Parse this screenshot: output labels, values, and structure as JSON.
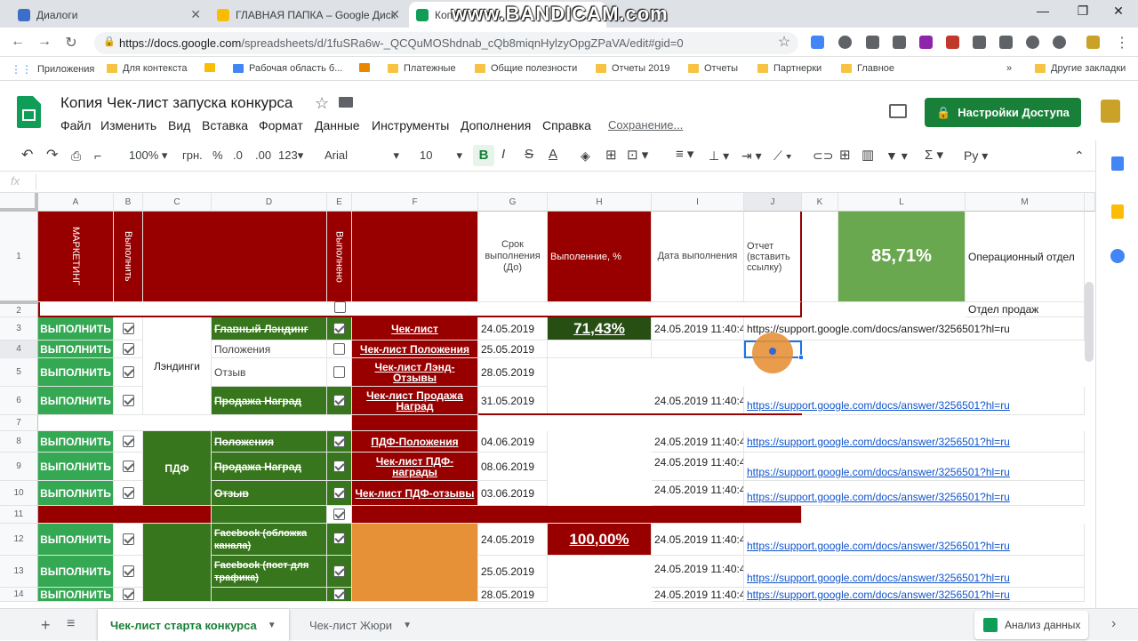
{
  "browser": {
    "tabs": [
      {
        "title": "Диалоги",
        "color": "#3d6ec9"
      },
      {
        "title": "ГЛАВНАЯ ПАПКА – Google Диск",
        "color": "#fbbc04"
      },
      {
        "title": "Копи",
        "color": "#0f9d58"
      }
    ],
    "watermark": "www.BANDICAM.com",
    "url_host": "https://docs.google.com",
    "url_path": "/spreadsheets/d/1fuSRa6w-_QCQuMOShdnab_cQb8miqnHylzyOpgZPaVA/edit#gid=0",
    "bookmarks": [
      "Приложения",
      "Для контекста",
      "Рабочая область б...",
      "Платежные",
      "Общие полезности",
      "Отчеты 2019",
      "Отчеты",
      "Партнерки",
      "Главное"
    ],
    "bookmarks_other": "Другие закладки"
  },
  "sheets": {
    "title": "Копия Чек-лист запуска конкурса",
    "menu": [
      "Файл",
      "Изменить",
      "Вид",
      "Вставка",
      "Формат",
      "Данные",
      "Инструменты",
      "Дополнения",
      "Справка"
    ],
    "saving": "Сохранение...",
    "share_label": "Настройки Доступа",
    "toolbar": {
      "zoom": "100%",
      "currency": "грн.",
      "percent": "%",
      "dec_less": ".0",
      "dec_more": ".00",
      "format_more": "123",
      "font": "Arial",
      "size": "10",
      "input_tool": "Ру"
    },
    "fx": "fx"
  },
  "grid": {
    "columns": [
      "A",
      "B",
      "C",
      "D",
      "E",
      "F",
      "G",
      "H",
      "I",
      "J",
      "K",
      "L",
      "M"
    ],
    "rows": [
      "1",
      "2",
      "3",
      "4",
      "5",
      "6",
      "7",
      "8",
      "9",
      "10",
      "11",
      "12",
      "13",
      "14"
    ],
    "r1": {
      "a": "МАРКЕТИНГ",
      "b": "Выполнить",
      "e": "Выполнено",
      "g": "Срок выполнения (До)",
      "h": "Выполенние, %",
      "i": "Дата выполнения",
      "j": "Отчет (вставить ссылку)",
      "l": "85,71%",
      "m": "Операционный отдел"
    },
    "r2_m": "Отдел продаж",
    "action": "ВЫПОЛНИТЬ",
    "group_landings": "Лэндинги",
    "group_pdf": "ПДФ",
    "percent_landings": "71,43%",
    "percent_fb": "100,00%",
    "items": {
      "r3": {
        "d": "Главный Лэндинг",
        "f": "Чек-лист",
        "g": "24.05.2019",
        "i": "24.05.2019 11:40:4",
        "j": "https://support.google.com/docs/answer/3256501?hl=ru"
      },
      "r4": {
        "d": "Положения",
        "f": "Чек-лист Положения",
        "g": "25.05.2019"
      },
      "r5": {
        "d": "Отзыв",
        "f": "Чек-лист Лэнд-Отзывы",
        "g": "28.05.2019"
      },
      "r6": {
        "d": "Продажа Наград",
        "f": "Чек-лист Продажа Наград",
        "g": "31.05.2019",
        "i": "24.05.2019 11:40:4",
        "j": "https://support.google.com/docs/answer/3256501?hl=ru"
      },
      "r8": {
        "d": "Положения",
        "f": "ПДФ-Положения",
        "g": "04.06.2019",
        "i": "24.05.2019 11:40:4",
        "j": "https://support.google.com/docs/answer/3256501?hl=ru"
      },
      "r9": {
        "d": "Продажа Наград",
        "f": "Чек-лист ПДФ-награды",
        "g": "08.06.2019",
        "i": "24.05.2019 11:40:4",
        "j": "https://support.google.com/docs/answer/3256501?hl=ru"
      },
      "r10": {
        "d": "Отзыв",
        "f": "Чек-лист ПДФ-отзывы",
        "g": "03.06.2019",
        "i": "24.05.2019 11:40:4",
        "j": "https://support.google.com/docs/answer/3256501?hl=ru"
      },
      "r12": {
        "d": "Facebook (обложка канала)",
        "g": "24.05.2019",
        "i": "24.05.2019 11:40:4",
        "j": "https://support.google.com/docs/answer/3256501?hl=ru"
      },
      "r13": {
        "d": "Facebook (пост для трафика)",
        "g": "25.05.2019",
        "i": "24.05.2019 11:40:4",
        "j": "https://support.google.com/docs/answer/3256501?hl=ru"
      },
      "r14": {
        "g": "28.05.2019",
        "i": "24.05.2019 11:40:4",
        "j": "https://support.google.com/docs/answer/3256501?hl=ru"
      }
    }
  },
  "bottom": {
    "tabs": [
      "Чек-лист старта конкурса",
      "Чек-лист Жюри"
    ],
    "explore": "Анализ данных"
  }
}
